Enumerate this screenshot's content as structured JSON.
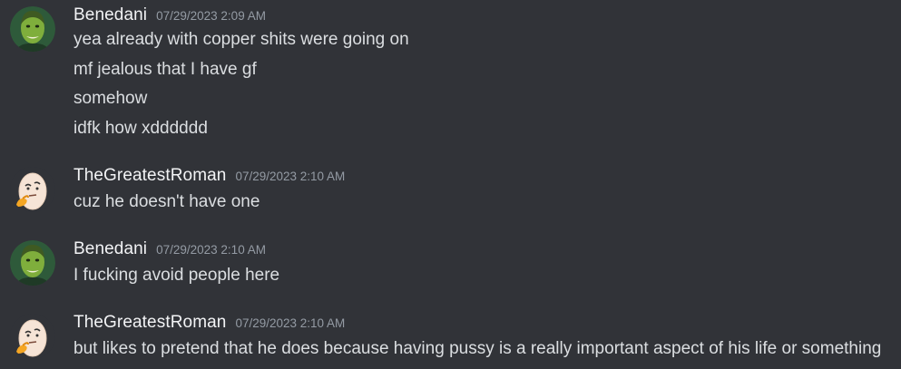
{
  "colors": {
    "background": "#313338",
    "username": "#f2f3f5",
    "timestamp": "#949ba4",
    "message_text": "#dbdee1"
  },
  "messages": [
    {
      "author": "Benedani",
      "avatar_icon": "green-face-avatar-icon",
      "timestamp": "07/29/2023 2:09 AM",
      "lines": [
        "yea already with copper shits were going on",
        "mf jealous that I have gf",
        "somehow",
        "idfk how xdddddd"
      ]
    },
    {
      "author": "TheGreatestRoman",
      "avatar_icon": "thinking-egg-avatar-icon",
      "timestamp": "07/29/2023 2:10 AM",
      "lines": [
        "cuz he doesn't have one"
      ]
    },
    {
      "author": "Benedani",
      "avatar_icon": "green-face-avatar-icon",
      "timestamp": "07/29/2023 2:10 AM",
      "lines": [
        "I fucking avoid people here"
      ]
    },
    {
      "author": "TheGreatestRoman",
      "avatar_icon": "thinking-egg-avatar-icon",
      "timestamp": "07/29/2023 2:10 AM",
      "lines": [
        "but likes to pretend that he does because having pussy is a really important aspect of his life or something"
      ]
    }
  ]
}
